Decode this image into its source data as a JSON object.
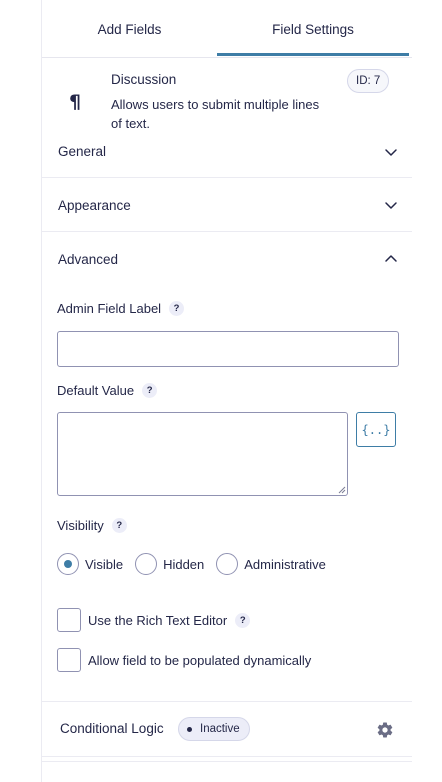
{
  "tabs": {
    "add_fields": "Add Fields",
    "field_settings": "Field Settings"
  },
  "field": {
    "icon": "paragraph-icon",
    "title": "Discussion",
    "description": "Allows users to submit multiple lines of text.",
    "id_badge": "ID: 7"
  },
  "sections": {
    "general": "General",
    "appearance": "Appearance",
    "advanced": "Advanced"
  },
  "advanced": {
    "admin_label": "Admin Field Label",
    "admin_value": "",
    "default_value_label": "Default Value",
    "default_value": "",
    "merge_tag_icon": "{..}",
    "visibility_label": "Visibility",
    "visibility_options": [
      "Visible",
      "Hidden",
      "Administrative"
    ],
    "visibility_selected": "Visible",
    "rich_text_label": "Use the Rich Text Editor",
    "rich_text_checked": false,
    "dynamic_label": "Allow field to be populated dynamically",
    "dynamic_checked": false,
    "help_glyph": "?"
  },
  "conditional": {
    "label": "Conditional Logic",
    "status": "Inactive"
  },
  "colors": {
    "accent": "#3e7da6",
    "text": "#242748",
    "border": "#9092b2"
  }
}
